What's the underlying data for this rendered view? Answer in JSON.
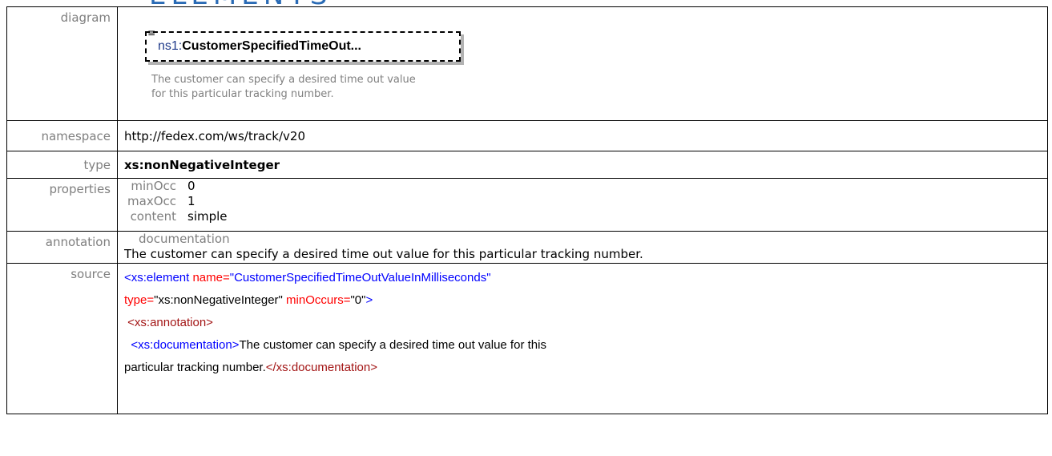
{
  "header_fragment": "ELEMENTS",
  "labels": {
    "diagram": "diagram",
    "namespace": "namespace",
    "type": "type",
    "properties": "properties",
    "annotation": "annotation",
    "source": "source"
  },
  "diagram": {
    "prefix": "ns1:",
    "name": "CustomerSpecifiedTimeOut...",
    "note": "The customer can specify a desired time out value for this particular tracking number."
  },
  "namespace": "http://fedex.com/ws/track/v20",
  "type": "xs:nonNegativeInteger",
  "properties": [
    {
      "key": "minOcc",
      "value": "0"
    },
    {
      "key": "maxOcc",
      "value": "1"
    },
    {
      "key": "content",
      "value": "simple"
    }
  ],
  "annotation": {
    "label": "documentation",
    "text": "The customer can specify a desired time out value for this particular tracking number."
  },
  "source": {
    "l1_tag": "<xs:element",
    "l1_attr1": " name=",
    "l1_val1": "\"CustomerSpecifiedTimeOutValueInMilliseconds\"",
    "l2_attr2": "type=",
    "l2_val2": "\"xs:nonNegativeInteger\"",
    "l2_attr3": " minOccurs=",
    "l2_val3": "\"0\"",
    "l2_close": ">",
    "l3_tag": " <xs:annotation>",
    "l4_open": "  <xs:documentation>",
    "l4_text": "The customer can specify a desired time out value for this",
    "l5_text": "particular tracking number.",
    "l5_close": "</xs:documentation>"
  }
}
